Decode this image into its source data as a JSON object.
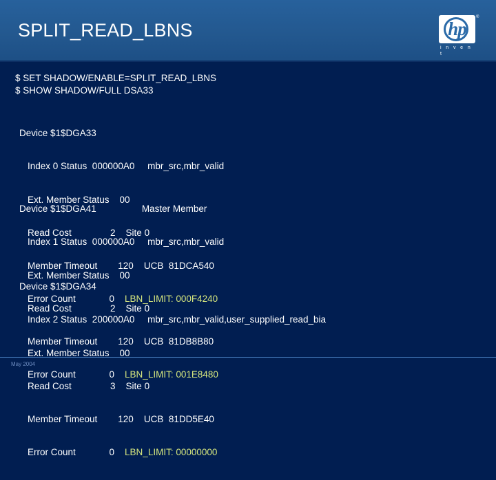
{
  "header": {
    "title": "SPLIT_READ_LBNS",
    "background_color": "#23588f",
    "logo": {
      "name": "hp-logo",
      "letters": "hp",
      "registered_mark": "®",
      "tagline": "i n v e n t"
    }
  },
  "console": {
    "background_color": "#011e51",
    "text_color": "#ffffff",
    "highlight_color": "#d6e77e",
    "commands": [
      "$ SET SHADOW/ENABLE=SPLIT_READ_LBNS",
      "$ SHOW SHADOW/FULL DSA33"
    ],
    "devices": [
      {
        "header": "Device $1$DGA33",
        "role": "",
        "lines": [
          "Index 0 Status  000000A0     mbr_src,mbr_valid",
          "Ext. Member Status    00",
          "Read Cost               2    Site 0",
          "Member Timeout        120    UCB  81DCA540",
          "Error Count             0    "
        ],
        "lbn_label": "LBN_LIMIT: 000F4240"
      },
      {
        "header": "Device $1$DGA41",
        "role": "Master Member",
        "lines": [
          "Index 1 Status  000000A0     mbr_src,mbr_valid",
          "Ext. Member Status    00",
          "Read Cost               2    Site 0",
          "Member Timeout        120    UCB  81DB8B80",
          "Error Count             0    "
        ],
        "lbn_label": "LBN_LIMIT: 001E8480"
      },
      {
        "header": "Device $1$DGA34",
        "role": "",
        "lines": [
          "Index 2 Status  200000A0     mbr_src,mbr_valid,user_supplied_read_bia",
          "Ext. Member Status    00",
          "Read Cost               3    Site 0",
          "Member Timeout        120    UCB  81DD5E40",
          "Error Count             0    "
        ],
        "lbn_label": "LBN_LIMIT: 00000000"
      }
    ]
  },
  "footer": {
    "date": "May 2004",
    "rule_color": "#4a7fc0"
  }
}
